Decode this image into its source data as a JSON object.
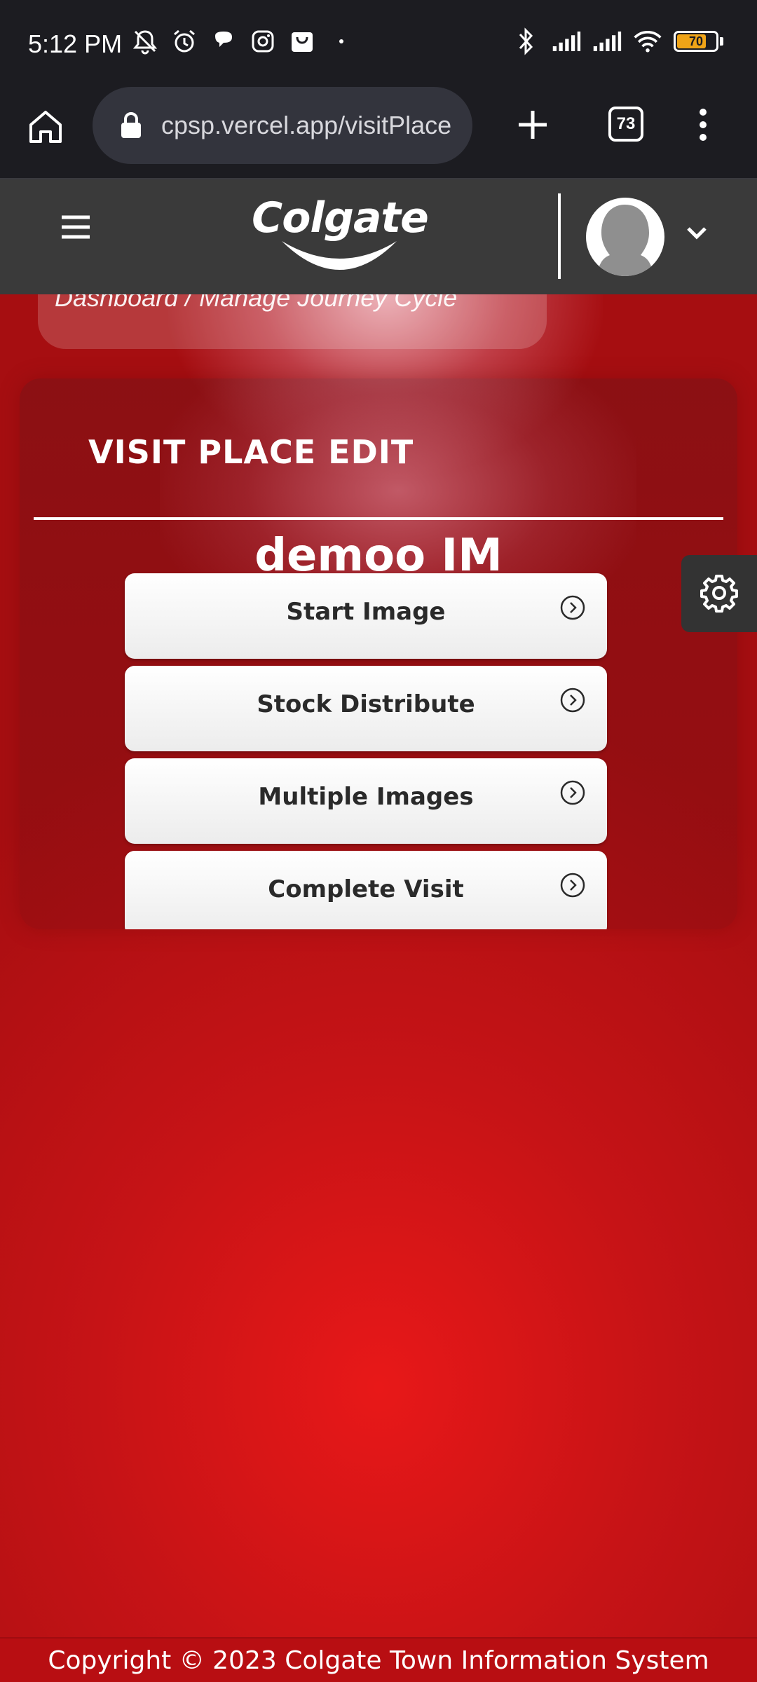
{
  "status_bar": {
    "time": "5:12 PM",
    "battery_level": "70",
    "icons_left": [
      "mute-icon",
      "alarm-icon",
      "chat-bubble-icon",
      "instagram-icon",
      "shopping-bag-icon",
      "dot-icon"
    ],
    "icons_right": [
      "bluetooth-icon",
      "signal-icon",
      "signal-icon",
      "wifi-icon",
      "battery-icon"
    ]
  },
  "browser": {
    "url": "cpsp.vercel.app/visitPlace",
    "tab_count": "73"
  },
  "header": {
    "logo_text": "Colgate"
  },
  "breadcrumb": {
    "text": "Dashboard / Manage Journey Cycle"
  },
  "card": {
    "title": "VISIT PLACE EDIT",
    "place_name": "demoo IM",
    "actions": [
      {
        "label": "Start Image"
      },
      {
        "label": "Stock Distribute"
      },
      {
        "label": "Multiple Images"
      },
      {
        "label": "Complete Visit"
      }
    ]
  },
  "footer": {
    "text": "Copyright © 2023 Colgate Town Information System"
  },
  "colors": {
    "brand_red": "#c61316",
    "header_bg": "#3a3a3a",
    "battery": "#f0a417"
  }
}
